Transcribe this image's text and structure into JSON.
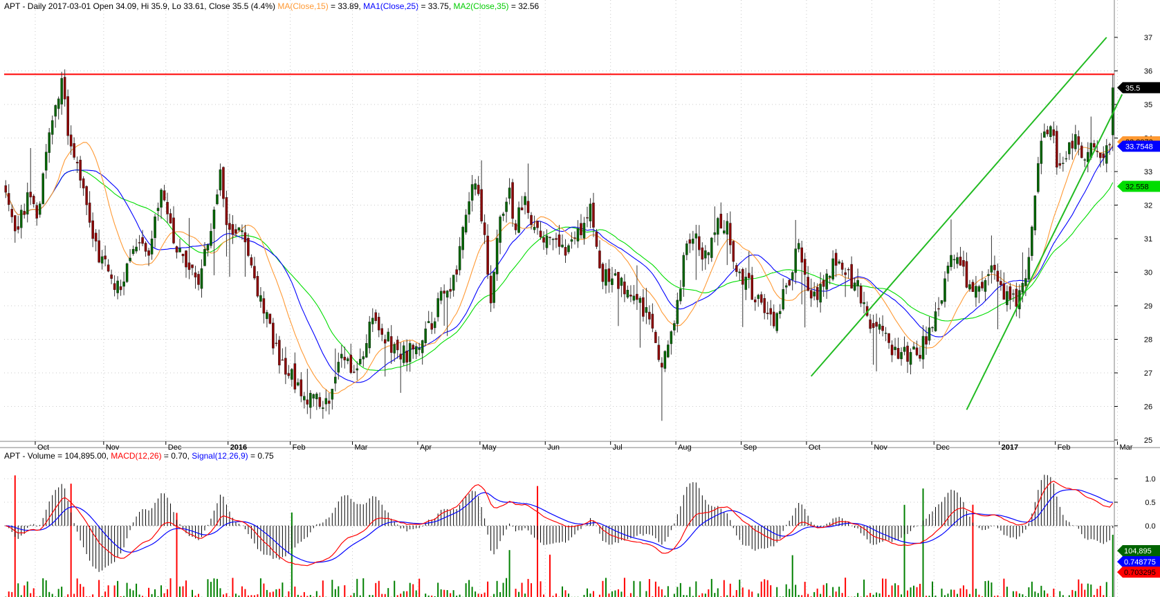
{
  "colors": {
    "up": "#006400",
    "down": "#8b0000",
    "ma15": "#ff9933",
    "ma25": "#0000ff",
    "ma35": "#00dd00",
    "resistance": "#ff0000",
    "trend": "#22bb22",
    "macd": "#ff0000",
    "signal": "#0000ff",
    "hist": "#000000",
    "vol_up": "#008000",
    "vol_down": "#ff0000"
  },
  "header": {
    "price": {
      "symbol_info": "APT - Daily 2017-03-01 Open 34.09, Hi 35.9, Lo 33.61, Close 35.5 (4.4%) ",
      "ma15_label": "MA(Close,15)",
      "ma15_value": " = 33.89, ",
      "ma25_label": "MA1(Close,25)",
      "ma25_value": " = 33.75, ",
      "ma35_label": "MA2(Close,35)",
      "ma35_value": " = 32.56"
    },
    "volume": {
      "vol_info": "APT - Volume = 104,895.00, ",
      "macd_label": "MACD(12,26)",
      "macd_value": " = 0.70, ",
      "signal_label": "Signal(12,26,9)",
      "signal_value": " = 0.75"
    }
  },
  "chart_data": [
    {
      "type": "candlestick",
      "title": "APT - Daily 2017-03-01 Open 34.09, Hi 35.9, Lo 33.61, Close 35.5 (4.4%)",
      "ylim": [
        25,
        37
      ],
      "y_ticks": [
        25,
        26,
        27,
        28,
        29,
        30,
        31,
        32,
        33,
        34,
        35,
        36,
        37
      ],
      "x_ticks": [
        {
          "label": "Oct",
          "i": 10,
          "bold": false
        },
        {
          "label": "Nov",
          "i": 32,
          "bold": false
        },
        {
          "label": "Dec",
          "i": 52,
          "bold": false
        },
        {
          "label": "2016",
          "i": 72,
          "bold": true
        },
        {
          "label": "Feb",
          "i": 92,
          "bold": false
        },
        {
          "label": "Mar",
          "i": 112,
          "bold": false
        },
        {
          "label": "Apr",
          "i": 133,
          "bold": false
        },
        {
          "label": "May",
          "i": 153,
          "bold": false
        },
        {
          "label": "Jun",
          "i": 174,
          "bold": false
        },
        {
          "label": "Jul",
          "i": 195,
          "bold": false
        },
        {
          "label": "Aug",
          "i": 216,
          "bold": false
        },
        {
          "label": "Sep",
          "i": 237,
          "bold": false
        },
        {
          "label": "Oct",
          "i": 258,
          "bold": false
        },
        {
          "label": "Nov",
          "i": 279,
          "bold": false
        },
        {
          "label": "Dec",
          "i": 299,
          "bold": false
        },
        {
          "label": "2017",
          "i": 320,
          "bold": true
        },
        {
          "label": "Feb",
          "i": 338,
          "bold": false
        },
        {
          "label": "Mar",
          "i": 358,
          "bold": false
        }
      ],
      "anchors": [
        [
          0,
          32.5
        ],
        [
          3,
          31.0
        ],
        [
          7,
          32.3
        ],
        [
          10,
          31.5
        ],
        [
          13,
          33.4
        ],
        [
          16,
          35.1
        ],
        [
          18,
          35.6
        ],
        [
          21,
          33.7
        ],
        [
          24,
          32.8
        ],
        [
          28,
          30.8
        ],
        [
          32,
          30.2
        ],
        [
          35,
          29.4
        ],
        [
          40,
          30.2
        ],
        [
          43,
          31.1
        ],
        [
          46,
          30.6
        ],
        [
          50,
          32.5
        ],
        [
          54,
          31.0
        ],
        [
          58,
          30.2
        ],
        [
          62,
          29.8
        ],
        [
          66,
          31.3
        ],
        [
          69,
          32.8
        ],
        [
          72,
          31.0
        ],
        [
          76,
          31.2
        ],
        [
          80,
          29.8
        ],
        [
          84,
          28.6
        ],
        [
          88,
          27.4
        ],
        [
          92,
          26.9
        ],
        [
          96,
          26.3
        ],
        [
          100,
          26.1
        ],
        [
          104,
          26.2
        ],
        [
          108,
          27.6
        ],
        [
          111,
          27.0
        ],
        [
          115,
          27.6
        ],
        [
          118,
          28.8
        ],
        [
          121,
          28.3
        ],
        [
          125,
          27.7
        ],
        [
          129,
          27.5
        ],
        [
          133,
          28.0
        ],
        [
          137,
          28.5
        ],
        [
          141,
          29.4
        ],
        [
          145,
          30.0
        ],
        [
          148,
          31.8
        ],
        [
          151,
          32.7
        ],
        [
          153,
          31.7
        ],
        [
          156,
          29.3
        ],
        [
          159,
          31.6
        ],
        [
          162,
          32.3
        ],
        [
          164,
          31.4
        ],
        [
          167,
          32.2
        ],
        [
          170,
          31.2
        ],
        [
          173,
          31.1
        ],
        [
          177,
          30.8
        ],
        [
          181,
          30.6
        ],
        [
          185,
          31.2
        ],
        [
          188,
          31.8
        ],
        [
          191,
          30.0
        ],
        [
          195,
          29.8
        ],
        [
          199,
          29.5
        ],
        [
          203,
          29.3
        ],
        [
          207,
          28.5
        ],
        [
          210,
          27.3
        ],
        [
          213,
          27.6
        ],
        [
          216,
          29.1
        ],
        [
          219,
          30.8
        ],
        [
          222,
          30.9
        ],
        [
          225,
          30.5
        ],
        [
          229,
          31.6
        ],
        [
          232,
          31.3
        ],
        [
          235,
          30.2
        ],
        [
          239,
          29.6
        ],
        [
          243,
          29.0
        ],
        [
          247,
          28.6
        ],
        [
          251,
          29.6
        ],
        [
          255,
          30.7
        ],
        [
          259,
          29.3
        ],
        [
          263,
          29.6
        ],
        [
          266,
          30.3
        ],
        [
          270,
          30.0
        ],
        [
          274,
          29.5
        ],
        [
          278,
          28.4
        ],
        [
          282,
          28.2
        ],
        [
          286,
          27.6
        ],
        [
          290,
          27.5
        ],
        [
          294,
          27.6
        ],
        [
          298,
          28.5
        ],
        [
          301,
          29.3
        ],
        [
          304,
          30.5
        ],
        [
          307,
          30.3
        ],
        [
          311,
          29.3
        ],
        [
          314,
          29.7
        ],
        [
          317,
          30.3
        ],
        [
          320,
          29.6
        ],
        [
          323,
          29.1
        ],
        [
          327,
          29.4
        ],
        [
          330,
          31.3
        ],
        [
          332,
          33.3
        ],
        [
          334,
          34.1
        ],
        [
          336,
          34.6
        ],
        [
          338,
          33.0
        ],
        [
          341,
          33.6
        ],
        [
          344,
          33.9
        ],
        [
          347,
          33.5
        ],
        [
          350,
          33.8
        ],
        [
          353,
          33.4
        ],
        [
          355,
          33.8
        ],
        [
          356,
          35.5
        ]
      ],
      "last_candle": {
        "date": "2017-03-01",
        "open": 34.09,
        "high": 35.9,
        "low": 33.61,
        "close": 35.5
      },
      "resistance": 35.9,
      "trend_channels": [
        {
          "from": [
            259,
            26.9
          ],
          "to": [
            354,
            37.0
          ]
        },
        {
          "from": [
            309,
            25.9
          ],
          "to": [
            359,
            35.3
          ]
        }
      ],
      "series": [
        {
          "name": "MA(Close,15)",
          "last": 33.89
        },
        {
          "name": "MA1(Close,25)",
          "last": 33.75
        },
        {
          "name": "MA2(Close,35)",
          "last": 32.56
        }
      ],
      "badges": [
        {
          "text": "35.5",
          "value": 35.5
        },
        {
          "text": "33.8873",
          "value": 33.8873
        },
        {
          "text": "33.7548",
          "value": 33.7548
        },
        {
          "text": "32.558",
          "value": 32.558
        }
      ]
    },
    {
      "type": "bar",
      "title": "APT - Volume = 104,895.00, MACD(12,26) = 0.70, Signal(12,26,9) = 0.75",
      "ylim": [
        -1.6,
        1.4
      ],
      "y_ticks": [
        0.0,
        0.5,
        1.0
      ],
      "series": [
        {
          "name": "Volume",
          "last": 104895
        },
        {
          "name": "MACD(12,26)",
          "last": 0.7
        },
        {
          "name": "Signal(12,26,9)",
          "last": 0.75
        }
      ],
      "badges": [
        {
          "text": "104,895",
          "value": "volume"
        },
        {
          "text": "0.748775",
          "value": 0.748775
        },
        {
          "text": "0.703295",
          "value": 0.703295
        }
      ]
    }
  ]
}
